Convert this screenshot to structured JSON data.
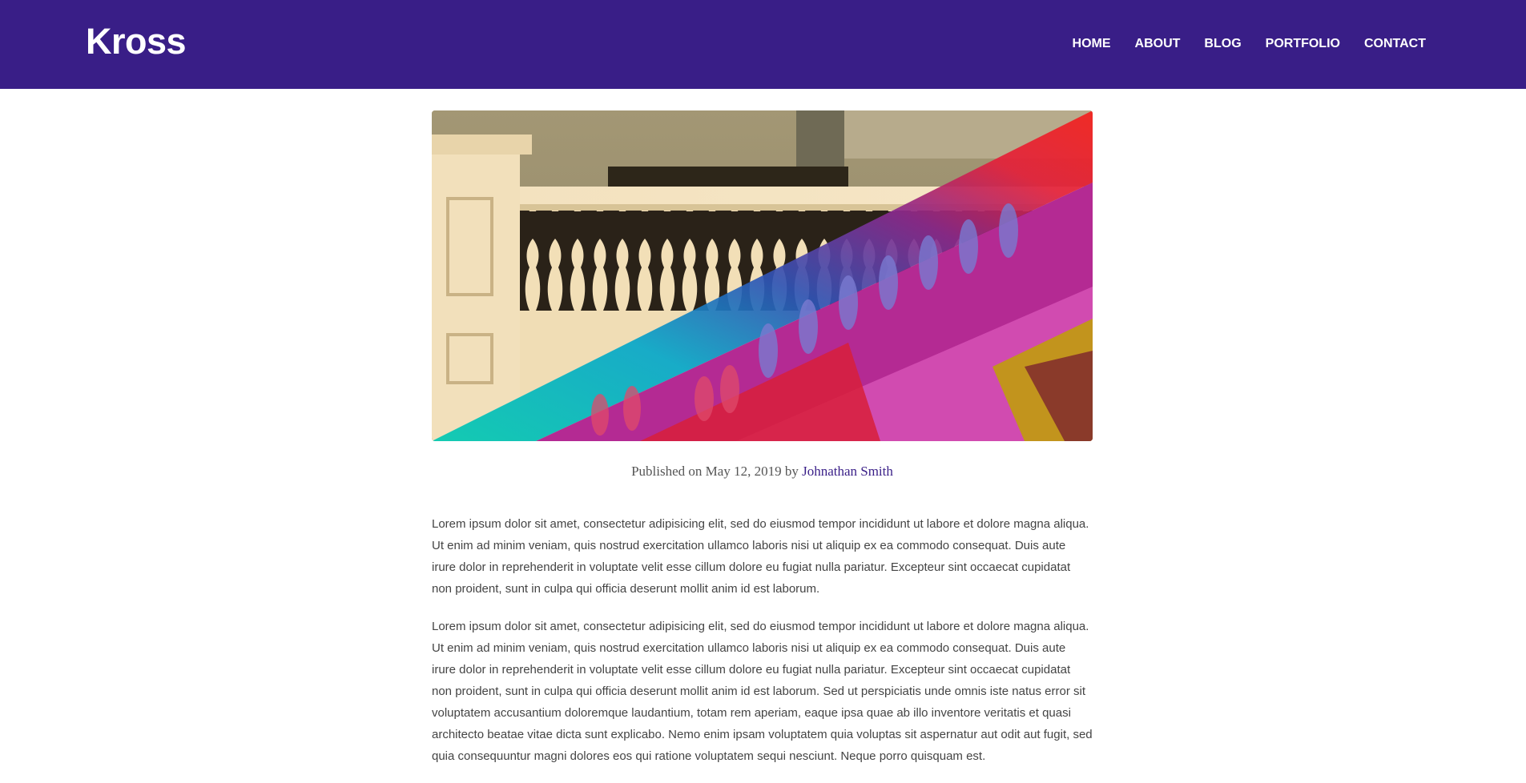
{
  "brand": {
    "name": "Kross"
  },
  "nav": {
    "items": [
      {
        "label": "HOME"
      },
      {
        "label": "ABOUT"
      },
      {
        "label": "BLOG"
      },
      {
        "label": "PORTFOLIO"
      },
      {
        "label": "CONTACT"
      }
    ]
  },
  "hero": {
    "icon": "colorful-staircase-photo"
  },
  "post": {
    "published_prefix": "Published on May 12, 2019 by",
    "author": "Johnathan Smith",
    "paragraphs": [
      "Lorem ipsum dolor sit amet, consectetur adipisicing elit, sed do eiusmod tempor incididunt ut labore et dolore magna aliqua. Ut enim ad minim veniam, quis nostrud exercitation ullamco laboris nisi ut aliquip ex ea commodo consequat. Duis aute irure dolor in reprehenderit in voluptate velit esse cillum dolore eu fugiat nulla pariatur. Excepteur sint occaecat cupidatat non proident, sunt in culpa qui officia deserunt mollit anim id est laborum.",
      "Lorem ipsum dolor sit amet, consectetur adipisicing elit, sed do eiusmod tempor incididunt ut labore et dolore magna aliqua. Ut enim ad minim veniam, quis nostrud exercitation ullamco laboris nisi ut aliquip ex ea commodo consequat. Duis aute irure dolor in reprehenderit in voluptate velit esse cillum dolore eu fugiat nulla pariatur. Excepteur sint occaecat cupidatat non proident, sunt in culpa qui officia deserunt mollit anim id est laborum. Sed ut perspiciatis unde omnis iste natus error sit voluptatem accusantium doloremque laudantium, totam rem aperiam, eaque ipsa quae ab illo inventore veritatis et quasi architecto beatae vitae dicta sunt explicabo. Nemo enim ipsam voluptatem quia voluptas sit aspernatur aut odit aut fugit, sed quia consequuntur magni dolores eos qui ratione voluptatem sequi nesciunt. Neque porro quisquam est."
    ]
  },
  "colors": {
    "navbar_bg": "#391e87",
    "link": "#391e87",
    "body_text": "#444444"
  }
}
